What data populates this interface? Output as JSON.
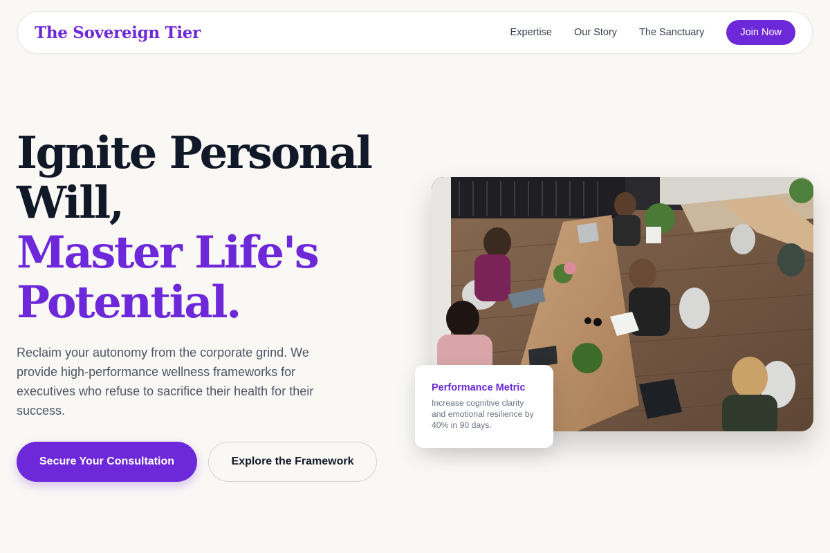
{
  "nav": {
    "brand": "The Sovereign Tier",
    "links": [
      {
        "label": "Expertise"
      },
      {
        "label": "Our Story"
      },
      {
        "label": "The Sanctuary"
      }
    ],
    "cta_label": "Join Now"
  },
  "hero": {
    "title_line1": "Ignite Personal",
    "title_line2": "Will,",
    "title_line3": "Master Life's",
    "title_line4": "Potential.",
    "description": "Reclaim your autonomy from the corporate grind. We provide high-performance wellness frameworks for executives who refuse to sacrifice their health for their success.",
    "primary_cta": "Secure Your Consultation",
    "secondary_cta": "Explore the Framework"
  },
  "image": {
    "alt": "Women working together at a long wooden table in a bright office"
  },
  "metric": {
    "title": "Performance Metric",
    "text": "Increase cognitive clarity and emotional resilience by 40% in 90 days."
  },
  "colors": {
    "accent": "#6d28d9",
    "background": "#faf8f5",
    "heading": "#111827",
    "body_text": "#4b5563"
  }
}
